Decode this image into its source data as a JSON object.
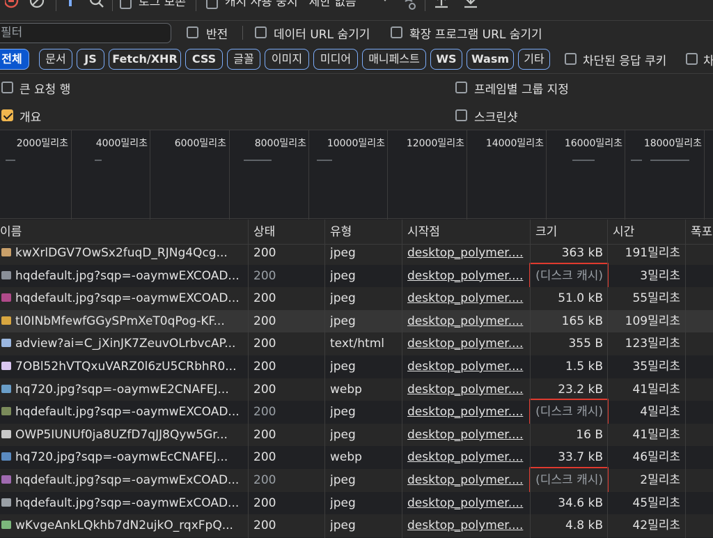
{
  "toolbar": {
    "preserve_log": "로그 보존",
    "disable_cache": "캐시 사용 중지",
    "throttle": "제한 없음"
  },
  "filter": {
    "placeholder": "필터",
    "invert": "반전",
    "hide_data_urls": "데이터 URL 숨기기",
    "hide_ext_urls": "확장 프로그램 URL 숨기기"
  },
  "chips": [
    "전체",
    "문서",
    "JS",
    "Fetch/XHR",
    "CSS",
    "글꼴",
    "이미지",
    "미디어",
    "매니페스트",
    "WS",
    "Wasm",
    "기타"
  ],
  "blocked_cookies": "차단된 응답 쿠키",
  "blocked_cookies_2": "차",
  "options": {
    "big_rows": "큰 요청 행",
    "group_by_frame": "프레임별 그룹 지정",
    "overview": "개요",
    "screenshots": "스크린샷"
  },
  "overview_ticks": [
    "2000밀리초",
    "4000밀리초",
    "6000밀리초",
    "8000밀리초",
    "10000밀리초",
    "12000밀리초",
    "14000밀리초",
    "16000밀리초",
    "18000밀리초"
  ],
  "columns": {
    "name": "이름",
    "status": "상태",
    "type": "유형",
    "initiator": "시작점",
    "size": "크기",
    "time": "시간",
    "waterfall": "폭포"
  },
  "rows": [
    {
      "name": "kwXrlDGV7OwSx2fuqD_RJNg4Qcg...",
      "status": "200",
      "type": "jpeg",
      "initiator": "desktop_polymer....",
      "size": "363 kB",
      "time": "191밀리초",
      "thumb": "#c9a06a"
    },
    {
      "name": "hqdefault.jpg?sqp=-oaymwEXCOAD...",
      "status": "200",
      "type": "jpeg",
      "initiator": "desktop_polymer....",
      "size": "(디스크 캐시)",
      "time": "3밀리초",
      "thumb": "#8a8f98"
    },
    {
      "name": "hqdefault.jpg?sqp=-oaymwEXCOAD...",
      "status": "200",
      "type": "jpeg",
      "initiator": "desktop_polymer....",
      "size": "51.0 kB",
      "time": "55밀리초",
      "thumb": "#b04a8a"
    },
    {
      "name": "tI0INbMfewfGGySPmXeT0qPog-KF...",
      "status": "200",
      "type": "jpeg",
      "initiator": "desktop_polymer....",
      "size": "165 kB",
      "time": "109밀리초",
      "thumb": "#d8a640"
    },
    {
      "name": "adview?ai=C_jXinJK7ZeuvOLrbvcAP...",
      "status": "200",
      "type": "text/html",
      "initiator": "desktop_polymer....",
      "size": "355 B",
      "time": "123밀리초",
      "thumb": "#9bb7e0"
    },
    {
      "name": "7OBl52hVTQxuVARZ0l6zU5CRbhR0...",
      "status": "200",
      "type": "jpeg",
      "initiator": "desktop_polymer....",
      "size": "1.5 kB",
      "time": "35밀리초",
      "thumb": "#d9c6f0"
    },
    {
      "name": "hq720.jpg?sqp=-oaymwE2CNAFEJ...",
      "status": "200",
      "type": "webp",
      "initiator": "desktop_polymer....",
      "size": "23.2 kB",
      "time": "41밀리초",
      "thumb": "#6a9ec8"
    },
    {
      "name": "hqdefault.jpg?sqp=-oaymwEXCOAD...",
      "status": "200",
      "type": "jpeg",
      "initiator": "desktop_polymer....",
      "size": "(디스크 캐시)",
      "time": "4밀리초",
      "thumb": "#7a8a5a"
    },
    {
      "name": "OWP5IUNUf0ja8UZfD7qJJ8Qyw5Gr...",
      "status": "200",
      "type": "jpeg",
      "initiator": "desktop_polymer....",
      "size": "16 B",
      "time": "41밀리초",
      "thumb": "#c8c8c8"
    },
    {
      "name": "hq720.jpg?sqp=-oaymwEcCNAFEJ...",
      "status": "200",
      "type": "webp",
      "initiator": "desktop_polymer....",
      "size": "33.7 kB",
      "time": "46밀리초",
      "thumb": "#5a8ac0"
    },
    {
      "name": "hqdefault.jpg?sqp=-oaymwExCOAD...",
      "status": "200",
      "type": "jpeg",
      "initiator": "desktop_polymer....",
      "size": "(디스크 캐시)",
      "time": "2밀리초",
      "thumb": "#a06ab0"
    },
    {
      "name": "hqdefault.jpg?sqp=-oaymwExCOAD...",
      "status": "200",
      "type": "jpeg",
      "initiator": "desktop_polymer....",
      "size": "34.6 kB",
      "time": "45밀리초",
      "thumb": "#9aa0a6"
    },
    {
      "name": "wKvgeAnkLQkhb7dN2ujkO_rqxFpQ...",
      "status": "200",
      "type": "jpeg",
      "initiator": "desktop_polymer....",
      "size": "4.8 kB",
      "time": "42밀리초",
      "thumb": "#7cb87c"
    }
  ],
  "colors": {
    "accent": "#7cacf8",
    "active_chip": "#0b57d0",
    "highlight_box": "#e03a2f",
    "checkbox_on": "#f0b64e",
    "record_stop": "#e2574c"
  }
}
